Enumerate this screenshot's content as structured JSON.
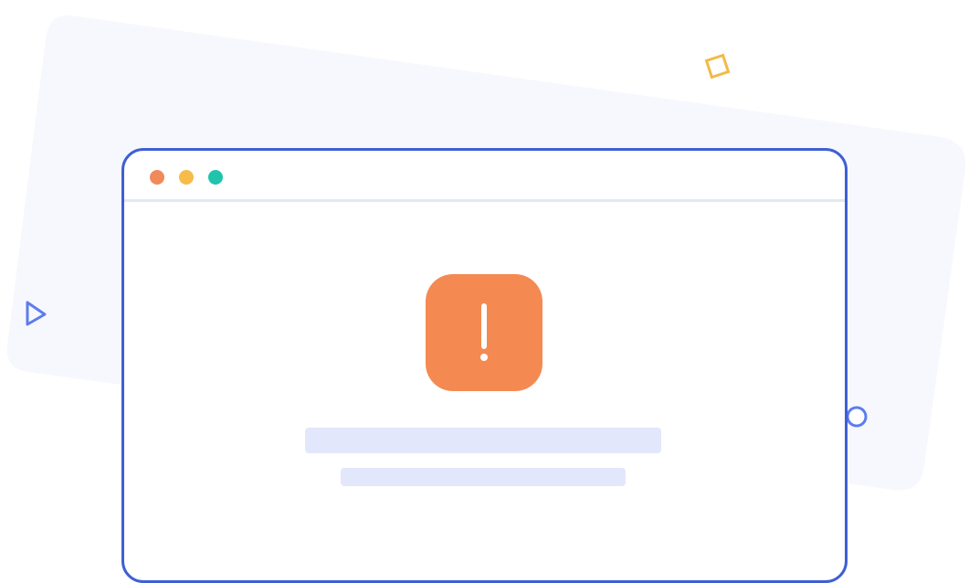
{
  "illustration": {
    "kind": "error-page-illustration",
    "window_controls": [
      "close",
      "minimize",
      "maximize"
    ],
    "icons": [
      "alert-exclamation-icon",
      "triangle-outline-icon",
      "square-outline-icon",
      "circle-outline-icon"
    ],
    "placeholder_lines": 2
  },
  "colors": {
    "window_border": "#3e5fd4",
    "backdrop": "#f7f8fd",
    "divider": "#e3e8f7",
    "control_close": "#f08a5b",
    "control_minimize": "#f7bb4a",
    "control_maximize": "#20c4ad",
    "alert": "#f48a52",
    "placeholder": "#e3e7fb",
    "accent_yellow": "#f2bb45",
    "accent_blue": "#5c7cf0"
  }
}
